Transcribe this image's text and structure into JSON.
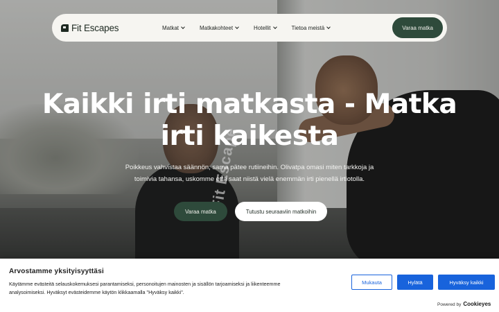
{
  "brand": {
    "name": "Fit Escapes",
    "logo_icon": "fit-escapes-logo-icon"
  },
  "nav": {
    "items": [
      {
        "label": "Matkat",
        "icon": "chevron-down-icon"
      },
      {
        "label": "Matkakohteet",
        "icon": "chevron-down-icon"
      },
      {
        "label": "Hotellit",
        "icon": "chevron-down-icon"
      },
      {
        "label": "Tietoa meistä",
        "icon": "chevron-down-icon"
      }
    ],
    "cta": "Varaa matka"
  },
  "hero": {
    "title_line1": "Kaikki irti matkasta - Matka",
    "title_line2": "irti kaikesta",
    "subtitle_line1": "Poikkeus vahvistaa säännön, sama pätee rutiineihin. Olivatpa omasi miten tarkkoja ja",
    "subtitle_line2": "toimivia tahansa, uskomme että saat niistä vielä enemmän irti pienellä irtiotolla.",
    "primary_cta": "Varaa matka",
    "secondary_cta": "Tutustu seuraaviin matkoihin",
    "jersey_text": "Fit Escape"
  },
  "cookie_banner": {
    "title": "Arvostamme yksityisyyttäsi",
    "text_line1": "Käytämme evästeitä selauskokemuksesi parantamiseksi, personoitujen mainosten ja sisällön tarjoamiseksi ja liikenteemme",
    "text_line2": "analysoimiseksi. Hyväksyt evästeidemme käytön klikkaamalla \"Hyväksy kaikki\".",
    "customize": "Mukauta",
    "reject": "Hylätä",
    "accept_all": "Hyväksy kaikki",
    "powered_label": "Powered by",
    "powered_brand": "Cookieyes"
  },
  "colors": {
    "brand_green": "#2e4a3b",
    "cookie_blue": "#1863dc",
    "nav_bg": "#f6f5f1"
  }
}
